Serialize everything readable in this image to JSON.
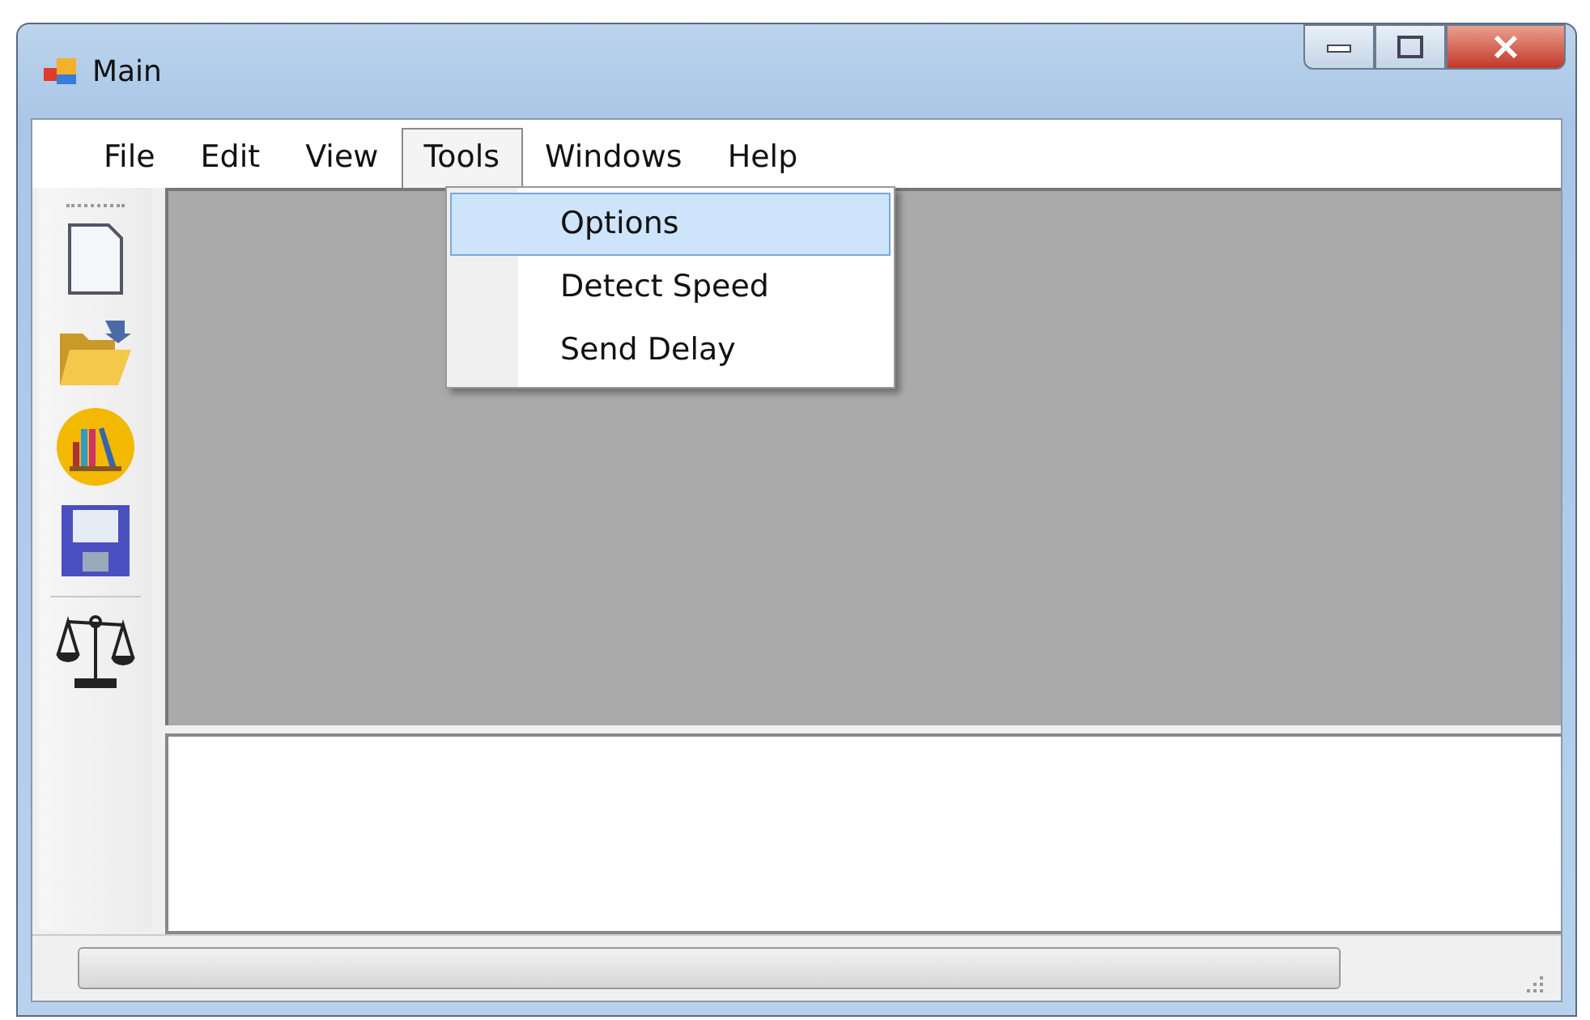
{
  "window": {
    "title": "Main"
  },
  "menu_bar": [
    {
      "label": "File",
      "selected": false
    },
    {
      "label": "Edit",
      "selected": false
    },
    {
      "label": "View",
      "selected": false
    },
    {
      "label": "Tools",
      "selected": true
    },
    {
      "label": "Windows",
      "selected": false
    },
    {
      "label": "Help",
      "selected": false
    }
  ],
  "dropdown": [
    {
      "label": "Options",
      "selected": true
    },
    {
      "label": "Detect Speed",
      "selected": false
    },
    {
      "label": "Send Delay",
      "selected": false
    }
  ],
  "toolbar": [
    {
      "kind": "new"
    },
    {
      "kind": "open"
    },
    {
      "kind": "books"
    },
    {
      "kind": "save"
    },
    {
      "kind": "separator"
    },
    {
      "kind": "scale"
    }
  ],
  "status_bar": {
    "progress": {
      "level": 0
    }
  }
}
